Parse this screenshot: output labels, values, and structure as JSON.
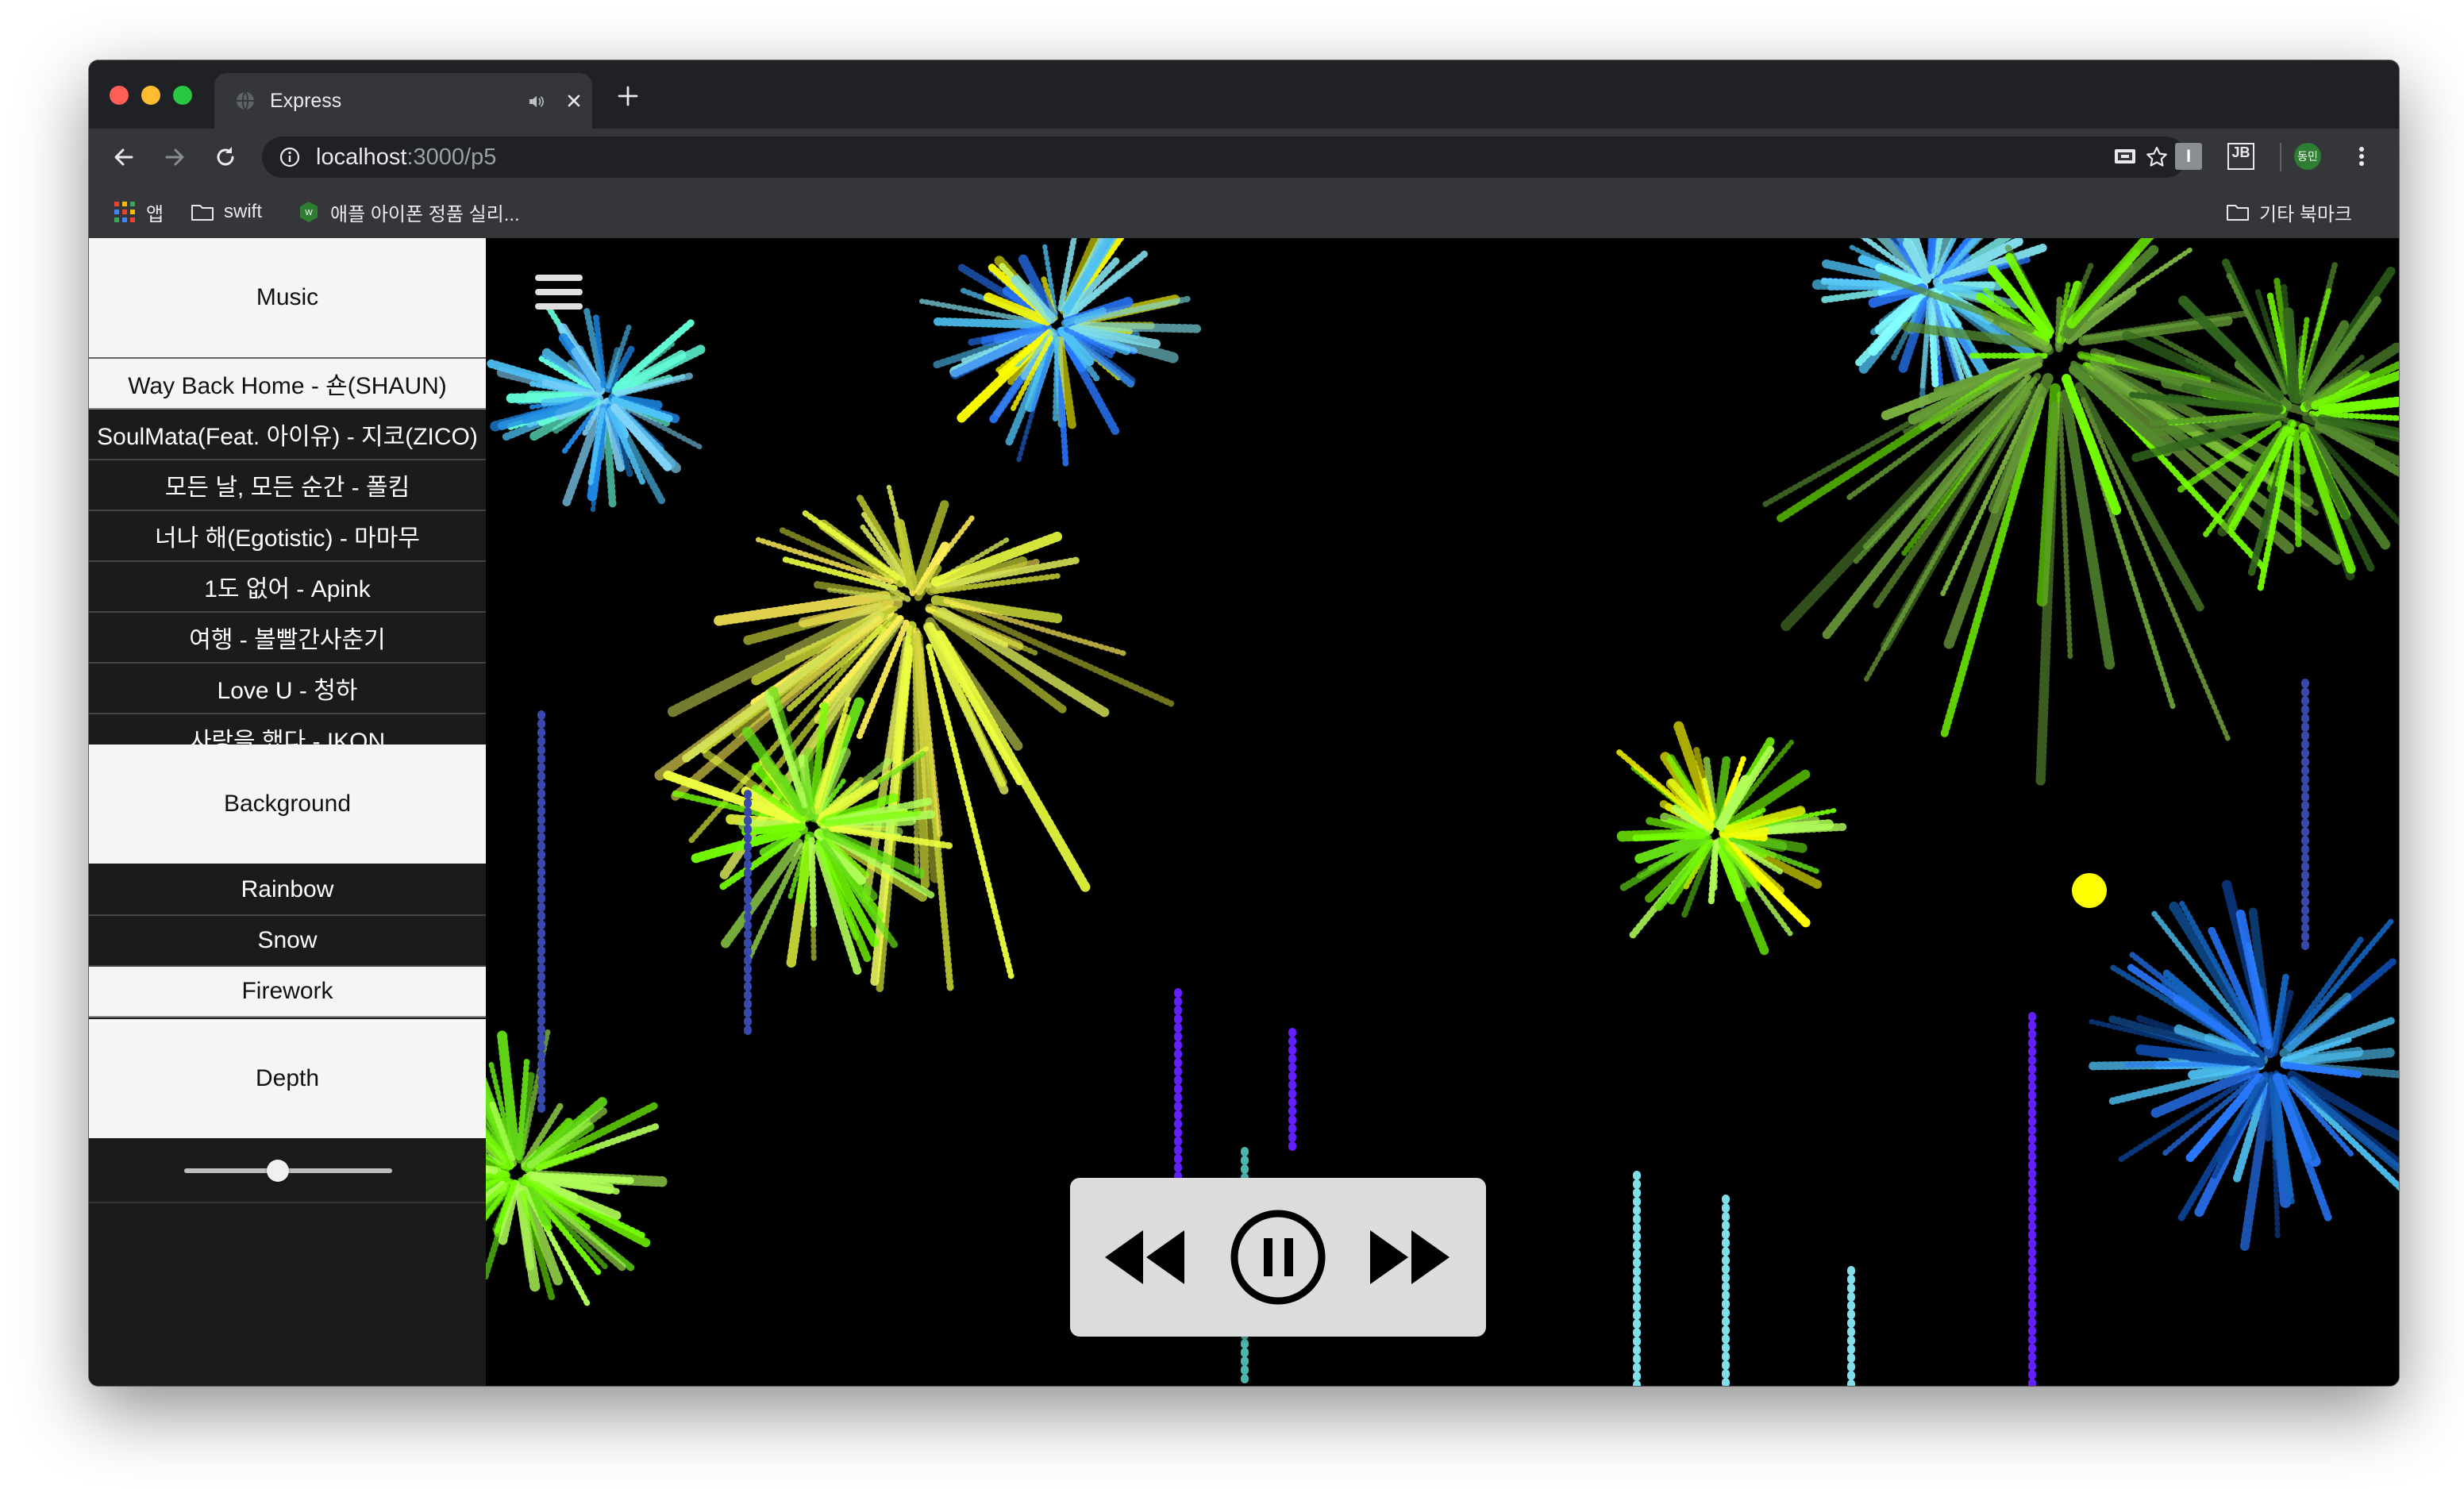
{
  "browser": {
    "tab_title": "Express",
    "url_host": "localhost",
    "url_path": ":3000/p5",
    "bookmarks": {
      "apps": "앱",
      "swift": "swift",
      "apple": "애플 아이폰 정품 실리...",
      "other": "기타 북마크"
    },
    "profile_initials": "동민",
    "ext_jb": "JB",
    "ext_i": "I"
  },
  "sidebar": {
    "music_header": "Music",
    "songs": [
      "Way Back Home - 숀(SHAUN)",
      "SoulMata(Feat. 아이유) - 지코(ZICO)",
      "모든 날, 모든 순간 - 폴킴",
      "너나 해(Egotistic) - 마마무",
      "1도 없어 - Apink",
      "여행 - 볼빨간사춘기",
      "Love U - 청하",
      "사랑을 했다 - IKON"
    ],
    "background_header": "Background",
    "backgrounds": [
      "Rainbow",
      "Snow",
      "Firework"
    ],
    "selected_background": "Firework",
    "depth_header": "Depth",
    "depth_value": 0.45
  },
  "player": {
    "state": "playing",
    "icons": [
      "rewind-icon",
      "pause-icon",
      "fast-forward-icon"
    ]
  },
  "colors": {
    "traffic_red": "#ff5f57",
    "traffic_yellow": "#febc2e",
    "traffic_green": "#28c840",
    "chrome_dark": "#202124",
    "chrome_mid": "#35363a"
  }
}
